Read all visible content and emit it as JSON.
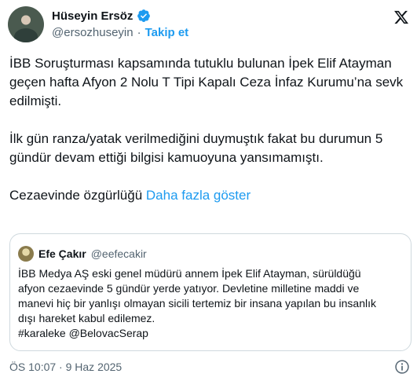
{
  "author": {
    "name": "Hüseyin Ersöz",
    "handle": "@ersozhuseyin",
    "separator": "·",
    "follow_label": "Takip et"
  },
  "icons": {
    "verified": "verified-badge-icon",
    "x_logo": "x-logo-icon",
    "info": "info-icon"
  },
  "colors": {
    "accent": "#1d9bf0",
    "text": "#0f1419",
    "muted": "#536471",
    "border": "#cfd9de"
  },
  "tweet": {
    "paragraphs": [
      "İBB Soruşturması kapsamında tutuklu bulunan İpek Elif Atayman geçen hafta Afyon 2 Nolu T Tipi Kapalı Ceza İnfaz Kurumu’na sevk edilmişti.",
      "İlk gün ranza/yatak verilmediğini duymuştık fakat bu durumun 5 gündür devam ettiği bilgisi kamuoyuna yansımamıştı."
    ],
    "last_line": "Cezaevinde özgürlüğü",
    "show_more": "Daha fazla göster"
  },
  "quote": {
    "name": "Efe Çakır",
    "handle": "@eefecakir",
    "lines": [
      "İBB Medya AŞ eski genel müdürü annem İpek Elif Atayman, sürüldüğü",
      "afyon cezaevinde 5 gündür yerde yatıyor. Devletine milletine maddi ve",
      "manevi hiç bir yanlışı olmayan sicili tertemiz bir insana yapılan bu insanlık",
      "dışı hareket kabul edilemez.",
      "#karaleke @BelovacSerap"
    ]
  },
  "meta": {
    "time": "ÖS 10:07",
    "separator": "·",
    "date": "9 Haz 2025"
  }
}
